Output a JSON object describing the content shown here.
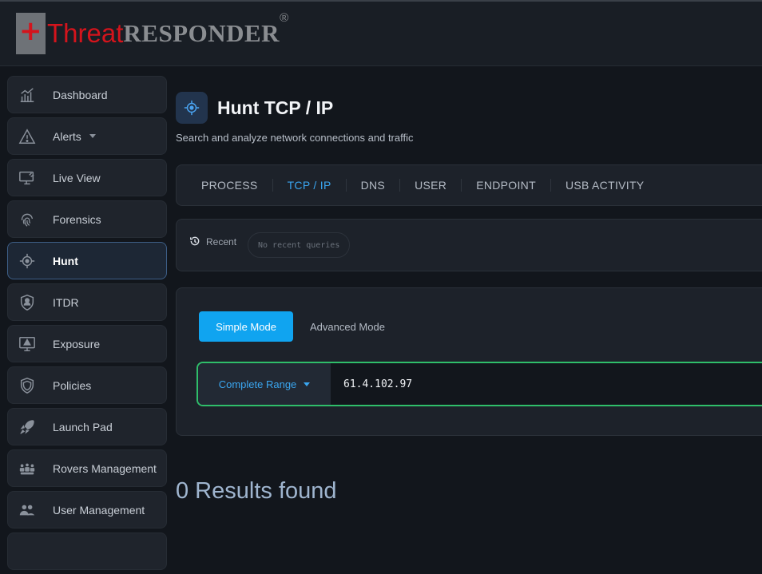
{
  "brand": {
    "logo_plus": "+",
    "logo_threat": "Threat",
    "logo_responder": "RESPONDER",
    "logo_reg": "®"
  },
  "sidebar": {
    "items": [
      {
        "label": "Dashboard",
        "icon": "chart-icon"
      },
      {
        "label": "Alerts",
        "icon": "warning-icon"
      },
      {
        "label": "Live View",
        "icon": "monitor-icon"
      },
      {
        "label": "Forensics",
        "icon": "fingerprint-icon"
      },
      {
        "label": "Hunt",
        "icon": "crosshair-icon",
        "active": true
      },
      {
        "label": "ITDR",
        "icon": "identity-icon"
      },
      {
        "label": "Exposure",
        "icon": "monitor-alert-icon"
      },
      {
        "label": "Policies",
        "icon": "shield-icon"
      },
      {
        "label": "Launch Pad",
        "icon": "rocket-icon"
      },
      {
        "label": "Rovers Management",
        "icon": "rovers-icon"
      },
      {
        "label": "User Management",
        "icon": "users-icon"
      }
    ]
  },
  "page": {
    "title": "Hunt TCP / IP",
    "subtitle": "Search and analyze network connections and traffic"
  },
  "tabs": [
    {
      "label": "PROCESS"
    },
    {
      "label": "TCP / IP",
      "active": true
    },
    {
      "label": "DNS"
    },
    {
      "label": "USER"
    },
    {
      "label": "ENDPOINT"
    },
    {
      "label": "USB ACTIVITY"
    }
  ],
  "recent": {
    "label": "Recent",
    "empty_text": "No recent queries"
  },
  "query": {
    "simple_mode": "Simple Mode",
    "advanced_mode": "Advanced Mode",
    "range_label": "Complete Range",
    "search_value": "61.4.102.97"
  },
  "results": {
    "text": "0 Results found"
  },
  "colors": {
    "accent": "#10a4f0",
    "active_tab": "#3aa6f0",
    "search_border": "#2fbe6a",
    "logo_red": "#d4141c"
  }
}
